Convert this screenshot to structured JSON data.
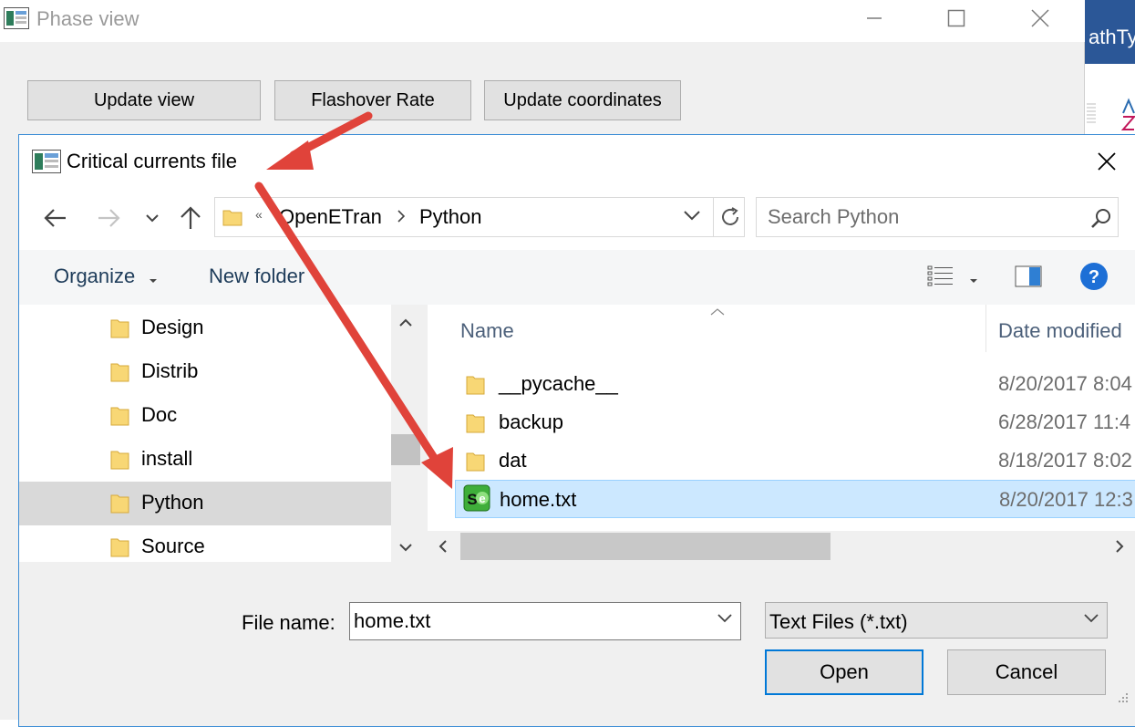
{
  "background_window": {
    "title": "Phase view",
    "buttons": {
      "update_view": "Update view",
      "flashover_rate": "Flashover Rate",
      "update_coordinates": "Update coordinates"
    },
    "side_app_text": "athTy"
  },
  "dialog": {
    "title": "Critical currents file",
    "address": {
      "overflow": "«",
      "segments": [
        "OpenETran",
        "Python"
      ]
    },
    "search": {
      "placeholder": "Search Python"
    },
    "toolbar": {
      "organize": "Organize",
      "new_folder": "New folder"
    },
    "nav_items": [
      {
        "label": "Design",
        "selected": false
      },
      {
        "label": "Distrib",
        "selected": false
      },
      {
        "label": "Doc",
        "selected": false
      },
      {
        "label": "install",
        "selected": false
      },
      {
        "label": "Python",
        "selected": true
      },
      {
        "label": "Source",
        "selected": false
      }
    ],
    "columns": {
      "name": "Name",
      "date_modified": "Date modified"
    },
    "files": [
      {
        "name": "__pycache__",
        "type": "folder",
        "date": "8/20/2017 8:04",
        "selected": false
      },
      {
        "name": "backup",
        "type": "folder",
        "date": "6/28/2017 11:4",
        "selected": false
      },
      {
        "name": "dat",
        "type": "folder",
        "date": "8/18/2017 8:02",
        "selected": false
      },
      {
        "name": "home.txt",
        "type": "file",
        "date": "8/20/2017 12:3",
        "selected": true
      }
    ],
    "file_name_label": "File name:",
    "file_name_value": "home.txt",
    "file_type": "Text Files (*.txt)",
    "open_label": "Open",
    "cancel_label": "Cancel"
  },
  "colors": {
    "annotation_arrow": "#e0433a",
    "selection": "#cce8ff",
    "accent": "#0078d7"
  }
}
